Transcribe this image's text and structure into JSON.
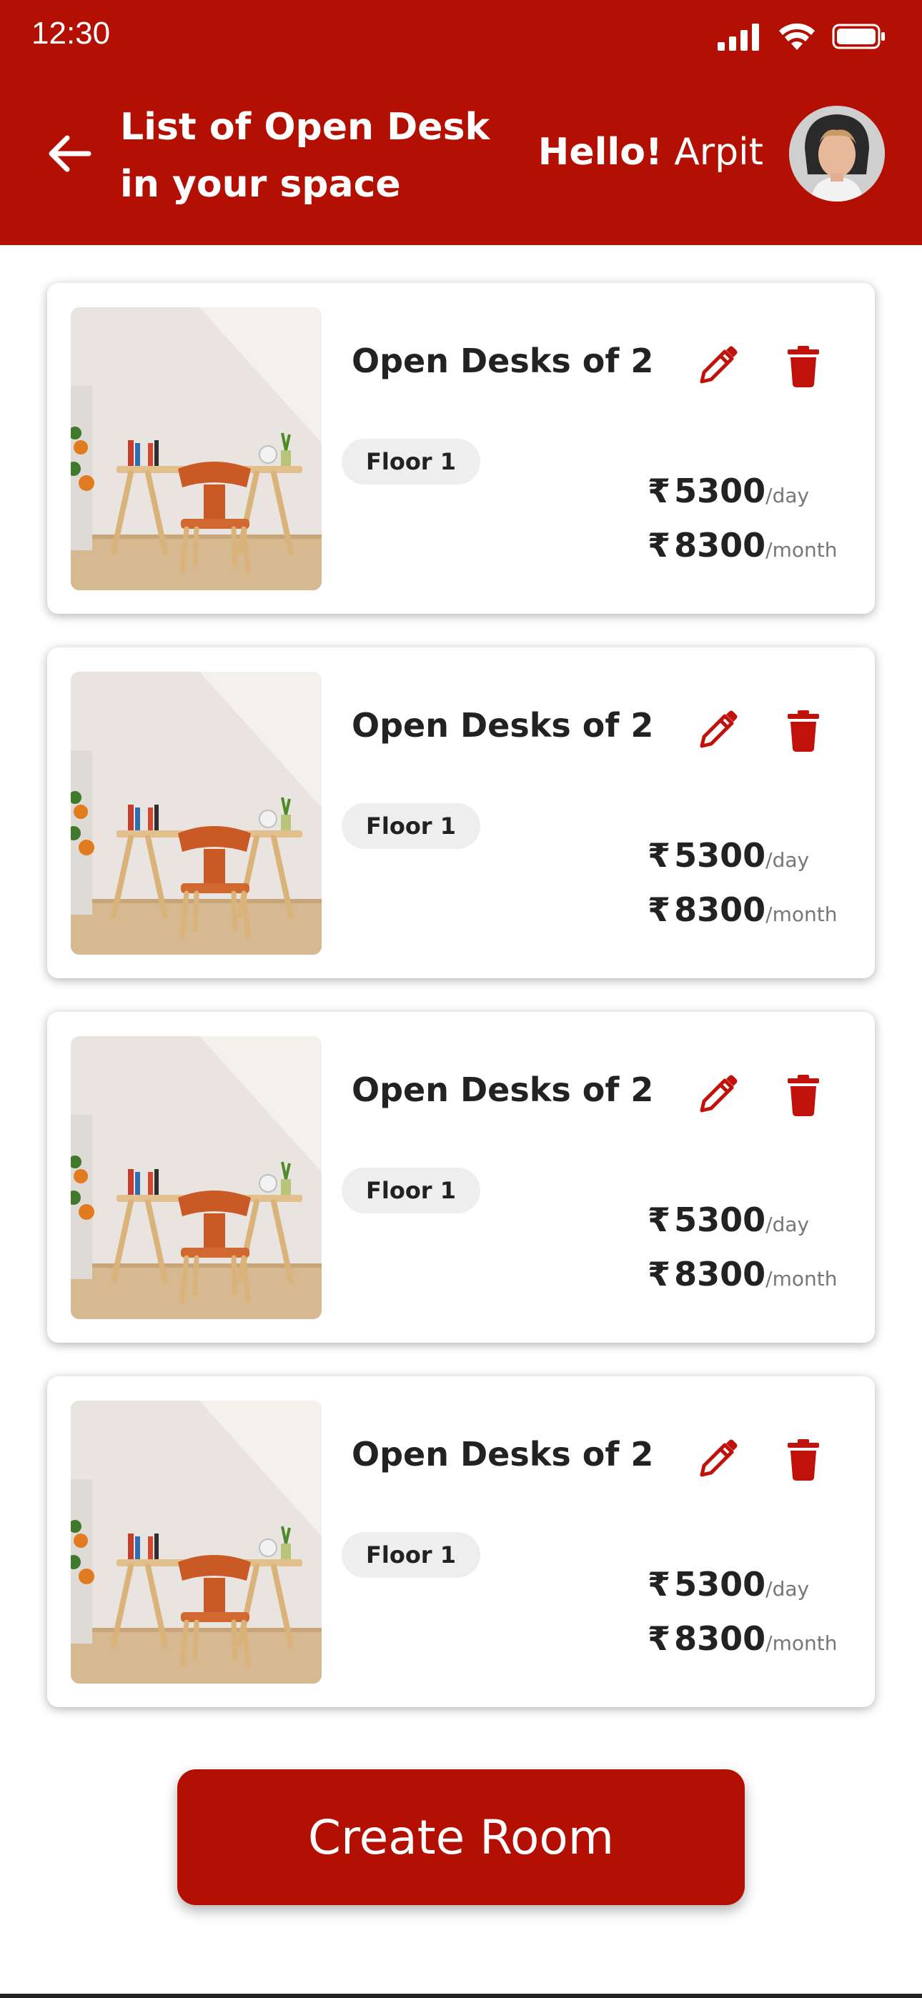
{
  "status_bar": {
    "time": "12:30"
  },
  "header": {
    "title": "List of Open Desk in your space",
    "greeting_hello": "Hello!",
    "greeting_name": "Arpit"
  },
  "listings": [
    {
      "title": "Open Desks of 2",
      "floor": "Floor 1",
      "currency": "₹",
      "price_day": "5300",
      "day_unit": "/day",
      "price_month": "8300",
      "month_unit": "/month"
    },
    {
      "title": "Open Desks of 2",
      "floor": "Floor 1",
      "currency": "₹",
      "price_day": "5300",
      "day_unit": "/day",
      "price_month": "8300",
      "month_unit": "/month"
    },
    {
      "title": "Open Desks of 2",
      "floor": "Floor 1",
      "currency": "₹",
      "price_day": "5300",
      "day_unit": "/day",
      "price_month": "8300",
      "month_unit": "/month"
    },
    {
      "title": "Open Desks of 2",
      "floor": "Floor 1",
      "currency": "₹",
      "price_day": "5300",
      "day_unit": "/day",
      "price_month": "8300",
      "month_unit": "/month"
    }
  ],
  "actions": {
    "create_room_label": "Create Room"
  },
  "theme": {
    "primary": "#b30f02",
    "icon_red": "#c0120a"
  },
  "icons": {
    "back": "arrow-left-icon",
    "edit": "pencil-icon",
    "delete": "trash-icon",
    "signal": "signal-icon",
    "wifi": "wifi-icon",
    "battery": "battery-icon"
  }
}
